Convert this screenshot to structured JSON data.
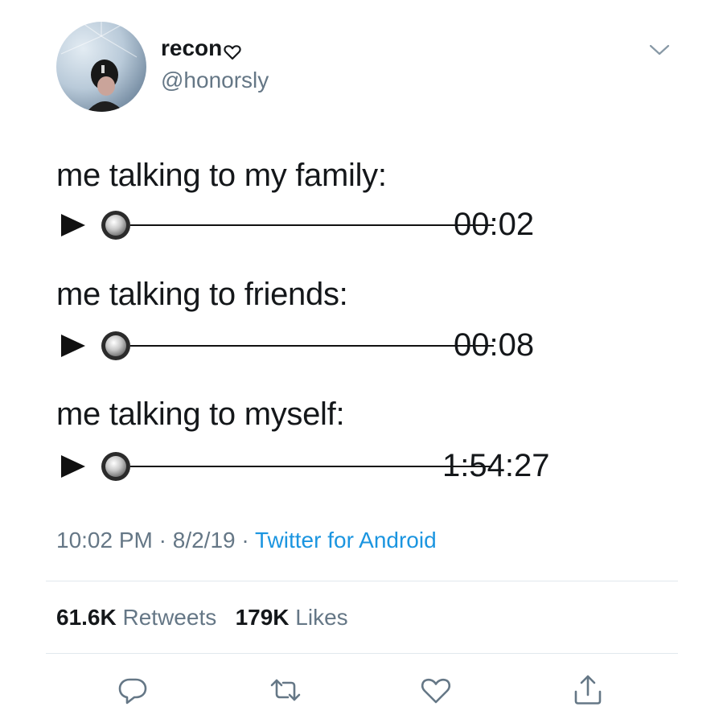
{
  "user": {
    "display_name": "recon",
    "handle": "@honorsly"
  },
  "tweet": {
    "lines": [
      {
        "text": "me talking to my family:",
        "duration": "00:02"
      },
      {
        "text": "me talking to friends:",
        "duration": "00:08"
      },
      {
        "text": "me talking to myself:",
        "duration": "1:54:27"
      }
    ]
  },
  "meta": {
    "time": "10:02 PM",
    "separator": "·",
    "date": "8/2/19",
    "source": "Twitter for Android"
  },
  "stats": {
    "retweets_count": "61.6K",
    "retweets_label": "Retweets",
    "likes_count": "179K",
    "likes_label": "Likes"
  },
  "icons": {
    "reply": "reply-icon",
    "retweet": "retweet-icon",
    "like": "heart-icon",
    "share": "share-icon",
    "caret": "chevron-down-icon",
    "play": "play-icon"
  },
  "colors": {
    "text": "#14171a",
    "secondary": "#657786",
    "link": "#1b95e0",
    "divider": "#e1e8ed"
  }
}
